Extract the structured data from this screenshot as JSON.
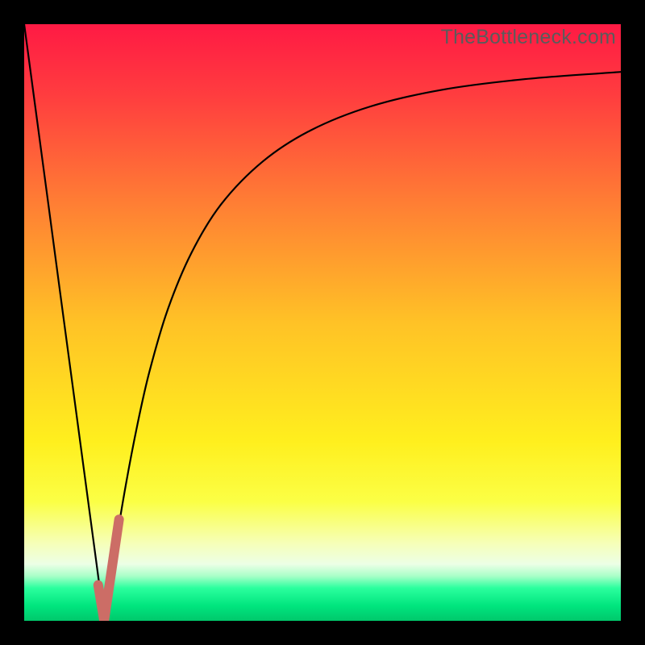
{
  "watermark": "TheBottleneck.com",
  "colors": {
    "frame": "#000000",
    "curve": "#000000",
    "marker": "#cc6d66",
    "gradient_stops": [
      {
        "offset": 0.0,
        "color": "#ff1a44"
      },
      {
        "offset": 0.12,
        "color": "#ff3d3f"
      },
      {
        "offset": 0.3,
        "color": "#ff7e34"
      },
      {
        "offset": 0.5,
        "color": "#ffc226"
      },
      {
        "offset": 0.7,
        "color": "#ffef1e"
      },
      {
        "offset": 0.8,
        "color": "#fbff45"
      },
      {
        "offset": 0.87,
        "color": "#f6ffb8"
      },
      {
        "offset": 0.905,
        "color": "#ecffe6"
      },
      {
        "offset": 0.925,
        "color": "#a9ffc8"
      },
      {
        "offset": 0.945,
        "color": "#2bff9e"
      },
      {
        "offset": 0.975,
        "color": "#00e57e"
      },
      {
        "offset": 1.0,
        "color": "#00c86b"
      }
    ]
  },
  "chart_data": {
    "type": "line",
    "title": "",
    "xlabel": "",
    "ylabel": "",
    "xlim": [
      0,
      100
    ],
    "ylim": [
      0,
      100
    ],
    "note": "Values are approximate percentages read from pixel positions; x is horizontal position (0=left edge of plot, 100=right), y is height (0=bottom, 100=top).",
    "series": [
      {
        "name": "left-branch",
        "x": [
          0,
          2,
          4,
          6,
          8,
          10,
          12,
          13.4
        ],
        "y": [
          100,
          85.1,
          70.2,
          55.2,
          40.3,
          25.4,
          10.5,
          0
        ]
      },
      {
        "name": "right-branch",
        "x": [
          13.4,
          15,
          17,
          19,
          21,
          24,
          28,
          33,
          40,
          48,
          58,
          70,
          84,
          100
        ],
        "y": [
          0,
          10.6,
          22.6,
          33.0,
          41.8,
          52.0,
          61.6,
          69.8,
          77.0,
          82.2,
          86.2,
          89.0,
          90.8,
          92.0
        ]
      }
    ],
    "marker": {
      "name": "optimal-region",
      "path_xy": [
        [
          12.4,
          6.0
        ],
        [
          13.4,
          0.0
        ],
        [
          15.9,
          17.0
        ]
      ],
      "stroke_width_px": 12
    }
  }
}
